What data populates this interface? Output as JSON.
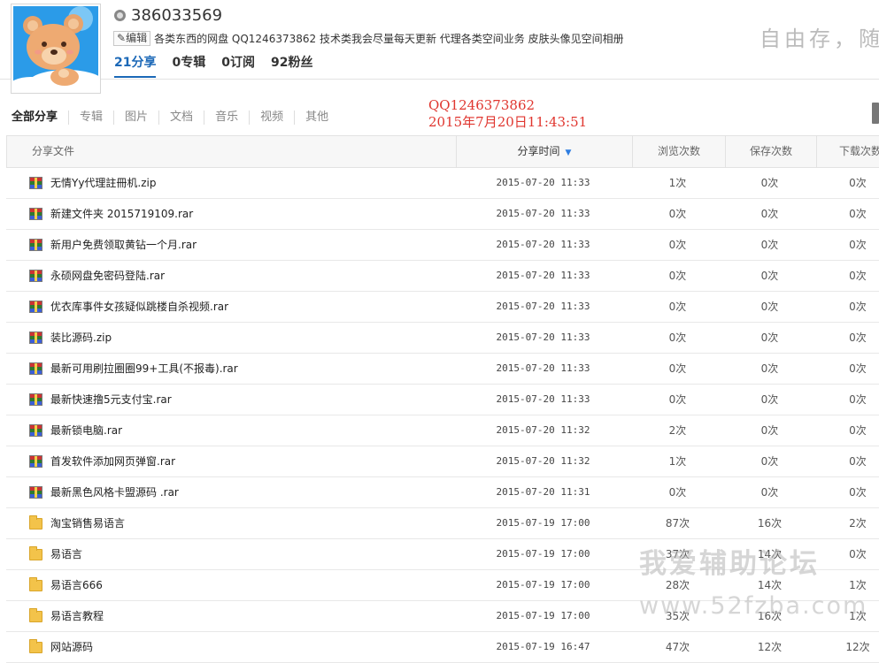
{
  "profile": {
    "user_id": "386033569",
    "edit_label": "编辑",
    "bio": "各类东西的网盘 QQ1246373862 技术类我会尽量每天更新 代理各类空间业务 皮肤头像见空间相册",
    "header_handwriting": "自由存，随",
    "stats": [
      {
        "label": "21分享"
      },
      {
        "label": "0专辑"
      },
      {
        "label": "0订阅"
      },
      {
        "label": "92粉丝"
      }
    ]
  },
  "filter_tabs": [
    "全部分享",
    "专辑",
    "图片",
    "文档",
    "音乐",
    "视频",
    "其他"
  ],
  "stamp": {
    "qq": "QQ1246373862",
    "datetime": "2015年7月20日11:43:51"
  },
  "table": {
    "headers": {
      "file": "分享文件",
      "time": "分享时间",
      "views": "浏览次数",
      "saves": "保存次数",
      "downloads": "下载次数"
    },
    "rows": [
      {
        "type": "archive",
        "name": "无情Yy代理註冊机.zip",
        "time": "2015-07-20 11:33",
        "views": "1次",
        "saves": "0次",
        "downloads": "0次"
      },
      {
        "type": "archive",
        "name": "新建文件夹 2015719109.rar",
        "time": "2015-07-20 11:33",
        "views": "0次",
        "saves": "0次",
        "downloads": "0次"
      },
      {
        "type": "archive",
        "name": "新用户免费领取黄钻一个月.rar",
        "time": "2015-07-20 11:33",
        "views": "0次",
        "saves": "0次",
        "downloads": "0次"
      },
      {
        "type": "archive",
        "name": "永硕网盘免密码登陆.rar",
        "time": "2015-07-20 11:33",
        "views": "0次",
        "saves": "0次",
        "downloads": "0次"
      },
      {
        "type": "archive",
        "name": "优衣库事件女孩疑似跳楼自杀视频.rar",
        "time": "2015-07-20 11:33",
        "views": "0次",
        "saves": "0次",
        "downloads": "0次"
      },
      {
        "type": "archive",
        "name": "装比源码.zip",
        "time": "2015-07-20 11:33",
        "views": "0次",
        "saves": "0次",
        "downloads": "0次"
      },
      {
        "type": "archive",
        "name": "最新可用刷拉圈圈99+工具(不报毒).rar",
        "time": "2015-07-20 11:33",
        "views": "0次",
        "saves": "0次",
        "downloads": "0次"
      },
      {
        "type": "archive",
        "name": "最新快速撸5元支付宝.rar",
        "time": "2015-07-20 11:33",
        "views": "0次",
        "saves": "0次",
        "downloads": "0次"
      },
      {
        "type": "archive",
        "name": "最新锁电脑.rar",
        "time": "2015-07-20 11:32",
        "views": "2次",
        "saves": "0次",
        "downloads": "0次"
      },
      {
        "type": "archive",
        "name": "首发软件添加网页弹窗.rar",
        "time": "2015-07-20 11:32",
        "views": "1次",
        "saves": "0次",
        "downloads": "0次"
      },
      {
        "type": "archive",
        "name": "最新黑色风格卡盟源码 .rar",
        "time": "2015-07-20 11:31",
        "views": "0次",
        "saves": "0次",
        "downloads": "0次"
      },
      {
        "type": "folder",
        "name": "淘宝销售易语言",
        "time": "2015-07-19 17:00",
        "views": "87次",
        "saves": "16次",
        "downloads": "2次"
      },
      {
        "type": "folder",
        "name": "易语言",
        "time": "2015-07-19 17:00",
        "views": "37次",
        "saves": "14次",
        "downloads": "0次"
      },
      {
        "type": "folder",
        "name": "易语言666",
        "time": "2015-07-19 17:00",
        "views": "28次",
        "saves": "14次",
        "downloads": "1次"
      },
      {
        "type": "folder",
        "name": "易语言教程",
        "time": "2015-07-19 17:00",
        "views": "35次",
        "saves": "16次",
        "downloads": "1次"
      },
      {
        "type": "folder",
        "name": "网站源码",
        "time": "2015-07-19 16:47",
        "views": "47次",
        "saves": "12次",
        "downloads": "12次"
      }
    ]
  },
  "watermark": {
    "line1": "我爱辅助论坛",
    "line2": "www.52fzba.com"
  },
  "colors": {
    "accent": "#1b68b7",
    "stamp": "#e0362f"
  }
}
